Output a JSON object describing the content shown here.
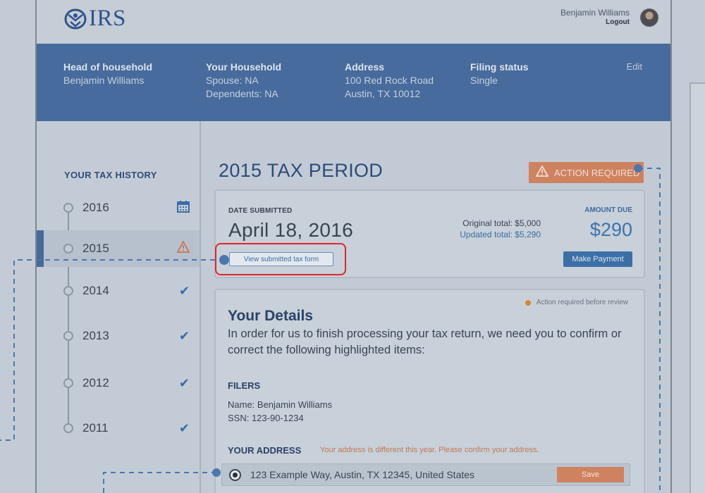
{
  "brand": {
    "logo_text": "IRS",
    "logo_icon": "eagle-icon"
  },
  "user": {
    "name": "Benjamin Williams",
    "logout": "Logout",
    "avatar": "avatar"
  },
  "household_bar": {
    "head": {
      "heading": "Head of household",
      "line1": "Benjamin Williams"
    },
    "household": {
      "heading": "Your Household",
      "line1": "Spouse: NA",
      "line2": "Dependents: NA"
    },
    "address": {
      "heading": "Address",
      "line1": "100 Red Rock Road",
      "line2": "Austin, TX 10012"
    },
    "filing": {
      "heading": "Filing status",
      "line1": "Single"
    },
    "edit": "Edit"
  },
  "sidebar": {
    "title": "YOUR TAX HISTORY",
    "years": [
      {
        "label": "2016",
        "icon": "calendar-icon",
        "active": false
      },
      {
        "label": "2015",
        "icon": "warning-icon",
        "active": true
      },
      {
        "label": "2014",
        "icon": "check-icon",
        "active": false
      },
      {
        "label": "2013",
        "icon": "check-icon",
        "active": false
      },
      {
        "label": "2012",
        "icon": "check-icon",
        "active": false
      },
      {
        "label": "2011",
        "icon": "check-icon",
        "active": false
      }
    ]
  },
  "period": {
    "title": "2015 TAX PERIOD",
    "action_badge": "ACTION REQUIRED",
    "date_label": "DATE SUBMITTED",
    "date": "April 18, 2016",
    "original_total": "Original total: $5,000",
    "updated_total": "Updated total: $5,290",
    "amount_label": "AMOUNT DUE",
    "amount": "$290",
    "pay_button": "Make Payment",
    "view_form_button": "View submitted tax form"
  },
  "details": {
    "legend": "Action required before review",
    "title": "Your Details",
    "text": "In order for us to finish processing your tax return, we need you to confirm or correct the following highlighted items:",
    "filers_heading": "FILERS",
    "filer_name": "Name: Benjamin Williams",
    "filer_ssn": "SSN: 123-90-1234",
    "address_heading": "YOUR ADDRESS",
    "address_note": "Your address is different this year. Please confirm your address.",
    "address_option": "123 Example Way, Austin, TX 12345, United States",
    "save_button": "Save"
  },
  "colors": {
    "brand_blue": "#476b9c",
    "action_orange": "#cf8260",
    "highlight_red": "#e0262a",
    "link_blue": "#3a6da5"
  }
}
